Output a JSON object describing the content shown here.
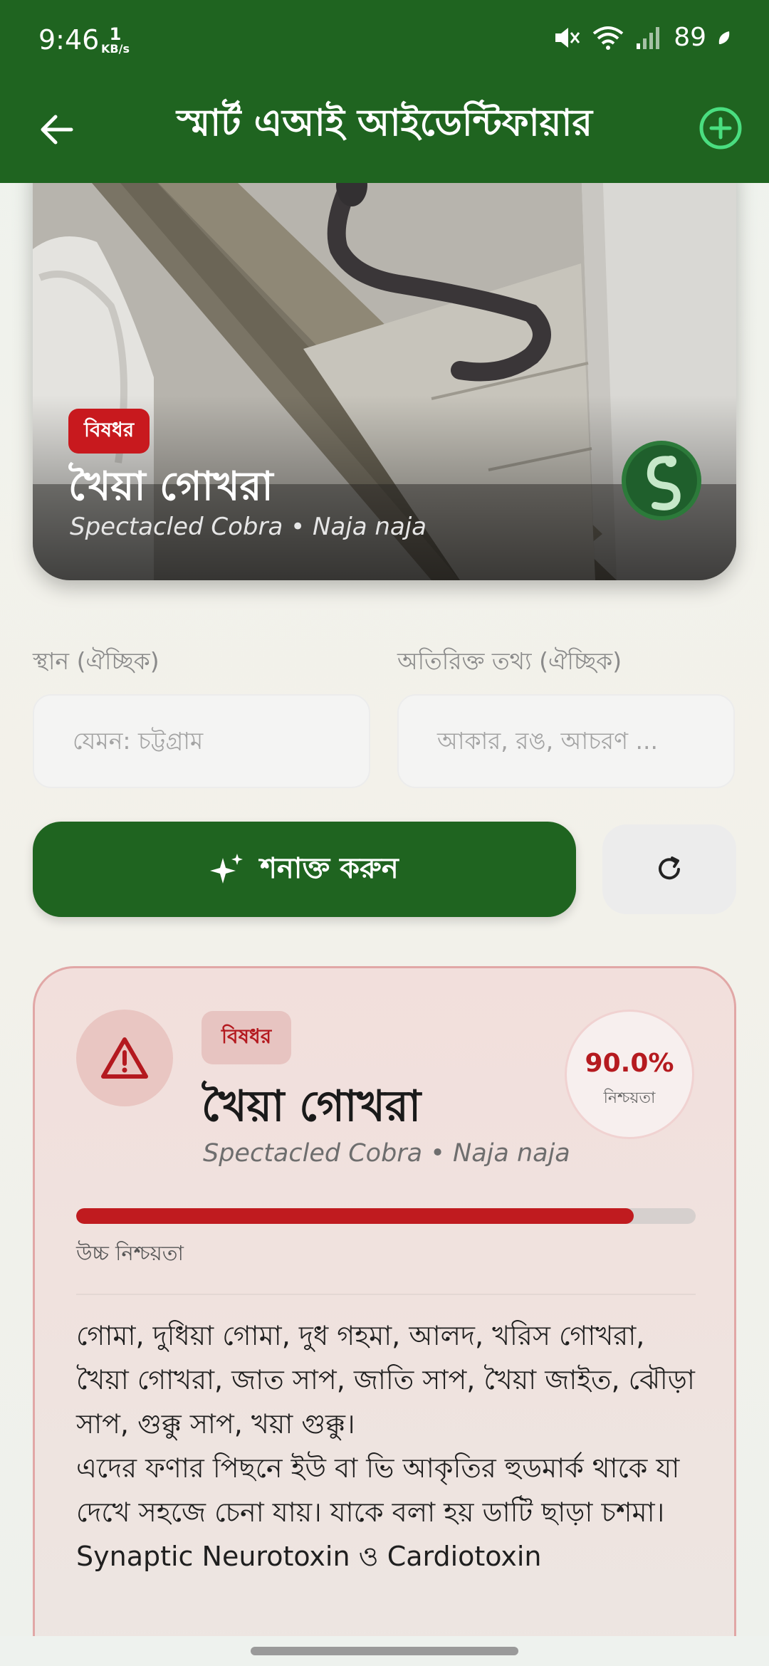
{
  "status_bar": {
    "time": "9:46",
    "net_speed_value": "1",
    "net_speed_unit": "KB/s",
    "battery": "89",
    "icons": [
      "mute-icon",
      "wifi-icon",
      "signal-icon",
      "battery-saver-icon"
    ]
  },
  "app_bar": {
    "title": "স্মার্ট এআই আইডেন্টিফায়ার",
    "back_icon": "arrow-left-icon",
    "add_icon": "plus-circle-icon"
  },
  "hero": {
    "badge": "বিষধর",
    "name": "খৈয়া গোখরা",
    "scientific": "Spectacled Cobra • Naja naja"
  },
  "form": {
    "location_label": "স্থান (ঐচ্ছিক)",
    "location_placeholder": "যেমন: চট্টগ্রাম",
    "extra_label": "অতিরিক্ত তথ্য (ঐচ্ছিক)",
    "extra_placeholder": "আকার, রঙ, আচরণ ...",
    "identify_button": "শনাক্ত করুন",
    "refresh_icon": "refresh-icon"
  },
  "result": {
    "badge": "বিষধর",
    "name": "খৈয়া গোখরা",
    "scientific": "Spectacled Cobra • Naja naja",
    "confidence_value": "90.0%",
    "confidence_label": "নিশ্চয়তা",
    "confidence_fraction": 0.9,
    "confidence_level": "উচ্চ নিশ্চয়তা",
    "description": [
      "গোমা, দুধিয়া গোমা, দুধ গহমা, আলদ, খরিস গোখরা, খৈয়া গোখরা, জাত সাপ, জাতি সাপ, খৈয়া জাইত, ঝৌড়া সাপ, গুক্কু সাপ, খয়া গুক্কু।",
      "এদের ফণার পিছনে ইউ বা ভি আকৃতির হুডমার্ক থাকে যা দেখে সহজে চেনা যায়। যাকে বলা হয় ডাটি ছাড়া চশমা।",
      "Synaptic Neurotoxin  ও Cardiotoxin"
    ]
  },
  "colors": {
    "primary_green": "#1f6420",
    "danger_red": "#c01b1f",
    "accent_light_green": "#4ade80"
  }
}
